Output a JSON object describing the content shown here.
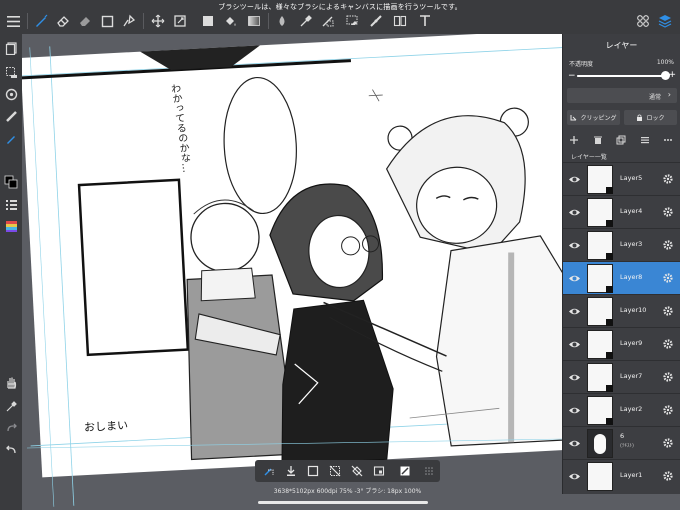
{
  "topbar": {
    "hint_text": "ブラシツールは、様々なブラシによるキャンバスに描画を行うツールです。"
  },
  "colors": {
    "accent": "#2f8fe6",
    "selected_layer": "#3a86d4",
    "panel_bg": "#3d3e42",
    "toolbar_bg": "#3a3b3e",
    "canvas_bg": "#5b5d63"
  },
  "canvas_text": {
    "bubble_text": "わかってるのかな…",
    "bottom_left_text": "おしまい"
  },
  "layer_panel": {
    "title": "レイヤー",
    "opacity_label": "不透明度",
    "opacity_value": "100%",
    "opacity_fraction": 1.0,
    "blend_mode": "通常",
    "clipping_label": "クリッピング",
    "lock_label": "ロック",
    "list_title": "レイヤー一覧",
    "layers": [
      {
        "name": "Layer5",
        "selected": false,
        "visible": true
      },
      {
        "name": "Layer4",
        "selected": false,
        "visible": true
      },
      {
        "name": "Layer3",
        "selected": false,
        "visible": true
      },
      {
        "name": "Layer8",
        "selected": true,
        "visible": true
      },
      {
        "name": "Layer10",
        "selected": false,
        "visible": true
      },
      {
        "name": "Layer9",
        "selected": false,
        "visible": true
      },
      {
        "name": "Layer7",
        "selected": false,
        "visible": true
      },
      {
        "name": "Layer2",
        "selected": false,
        "visible": true
      },
      {
        "name": "6",
        "sub": "(ﾃｷｽﾄ)",
        "selected": false,
        "visible": true
      },
      {
        "name": "Layer1",
        "selected": false,
        "visible": true
      }
    ]
  },
  "status": {
    "text": "3638*5102px 600dpi 75% -3° ブラシ: 18px 100%"
  }
}
